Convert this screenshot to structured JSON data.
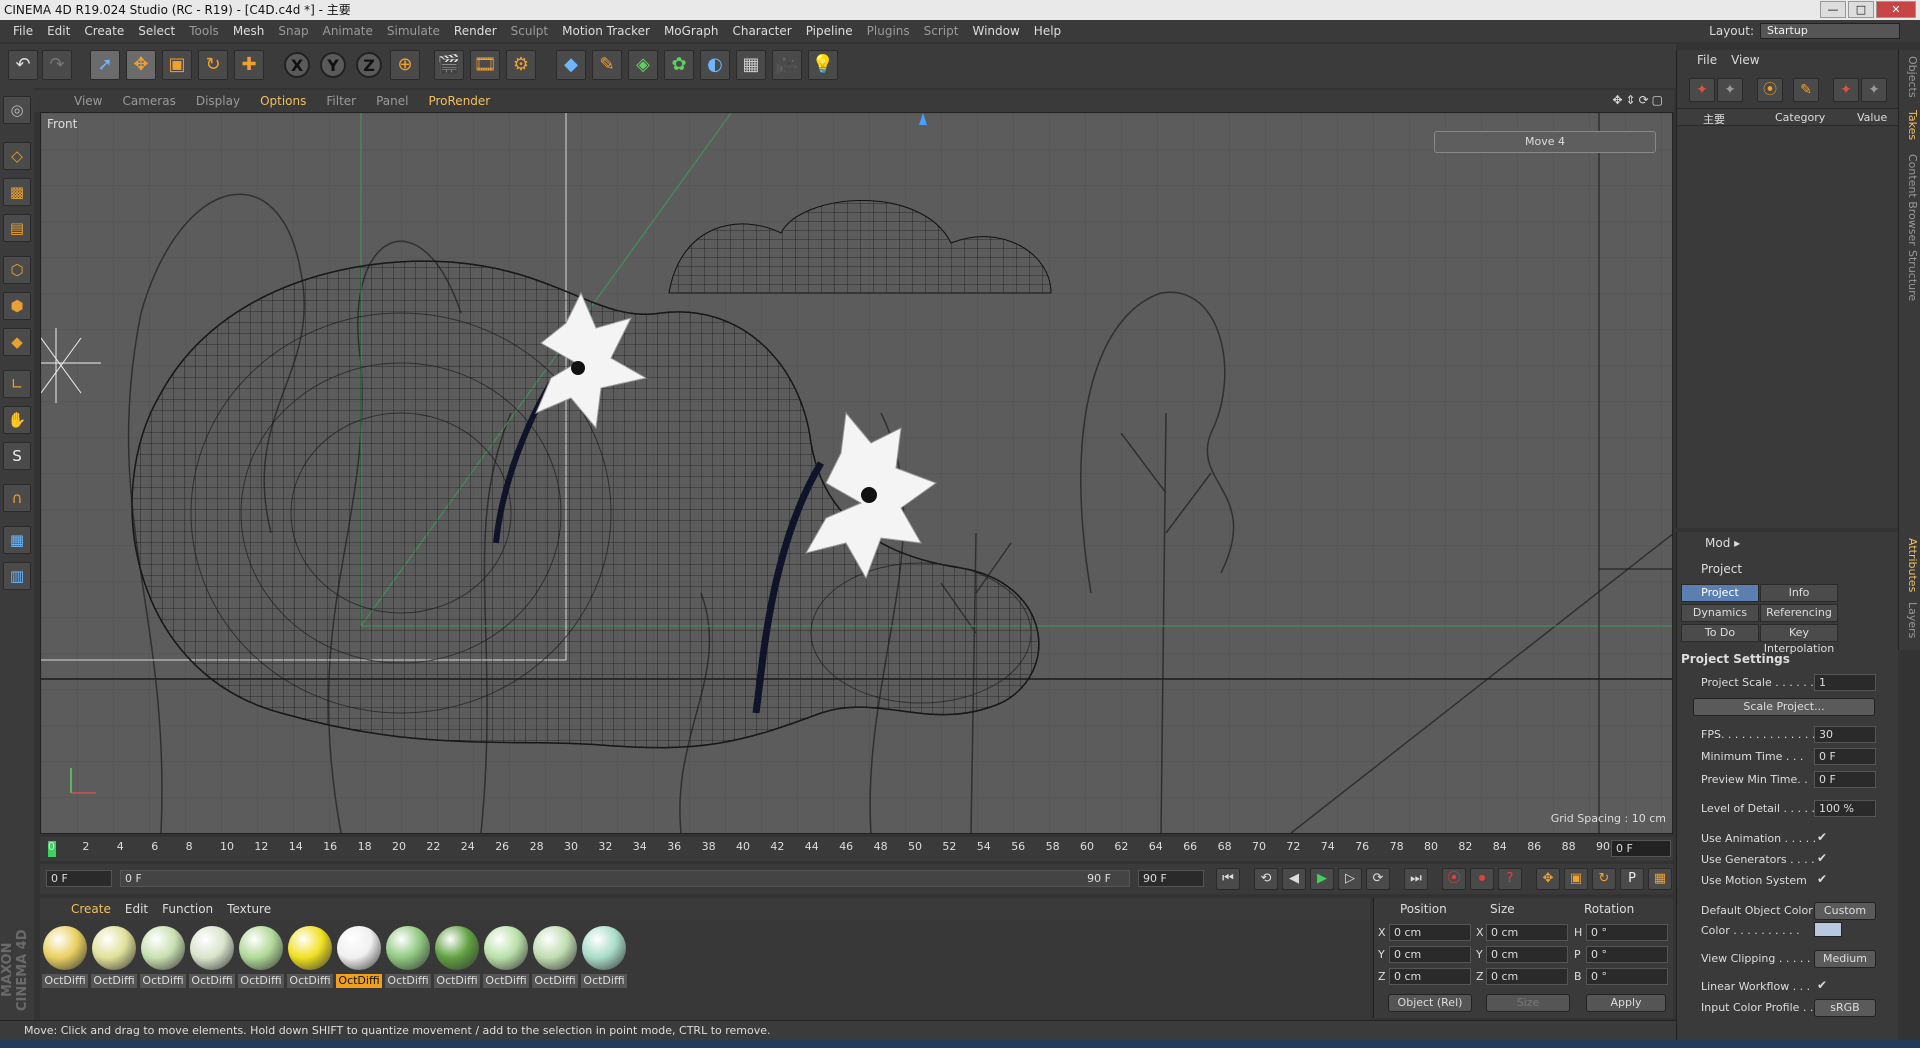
{
  "window": {
    "title": "CINEMA 4D R19.024 Studio (RC - R19) - [C4D.c4d *] - 主要",
    "buttons": [
      "—",
      "□",
      "✕"
    ]
  },
  "menu": [
    "File",
    "Edit",
    "Create",
    "Select",
    "Tools",
    "Mesh",
    "Snap",
    "Animate",
    "Simulate",
    "Render",
    "Sculpt",
    "Motion Tracker",
    "MoGraph",
    "Character",
    "Pipeline",
    "Plugins",
    "Script",
    "Window",
    "Help"
  ],
  "layout": {
    "label": "Layout:",
    "value": "Startup"
  },
  "toolbar_icons": [
    "undo-icon",
    "redo-icon",
    "select-live-icon",
    "move-icon",
    "scale-icon",
    "rotate-icon",
    "create-icon",
    "x-axis",
    "y-axis",
    "z-axis",
    "world-coords-icon",
    "render-view-icon",
    "render-picture-viewer-icon",
    "render-settings-icon",
    "cube-icon",
    "pen-icon",
    "subdivision-icon",
    "cloner-icon",
    "deformer-icon",
    "floor-icon",
    "camera-icon",
    "light-icon"
  ],
  "viewport": {
    "menu": [
      "View",
      "Cameras",
      "Display",
      "Options",
      "Filter",
      "Panel",
      "ProRender"
    ],
    "active_menu": "Options",
    "view_name": "Front",
    "hud_move": "Move 4",
    "grid_spacing": "Grid Spacing : 10 cm"
  },
  "timeline": {
    "ticks": [
      "0",
      "2",
      "4",
      "6",
      "8",
      "10",
      "12",
      "14",
      "16",
      "18",
      "20",
      "22",
      "24",
      "26",
      "28",
      "30",
      "32",
      "34",
      "36",
      "38",
      "40",
      "42",
      "44",
      "46",
      "48",
      "50",
      "52",
      "54",
      "56",
      "58",
      "60",
      "62",
      "64",
      "66",
      "68",
      "70",
      "72",
      "74",
      "76",
      "78",
      "80",
      "82",
      "84",
      "86",
      "88",
      "90"
    ],
    "current_frame": "0 F",
    "start": "0 F",
    "slider_start": "0 F",
    "slider_end": "90 F",
    "end": "90 F"
  },
  "materials": {
    "menu": [
      "Create",
      "Edit",
      "Function",
      "Texture"
    ],
    "active_menu": "Create",
    "items": [
      {
        "name": "OctDiffi",
        "color": "#e8d060"
      },
      {
        "name": "OctDiffi",
        "color": "#e0e098"
      },
      {
        "name": "OctDiffi",
        "color": "#c8e0b0"
      },
      {
        "name": "OctDiffi",
        "color": "#d8e4cc"
      },
      {
        "name": "OctDiffi",
        "color": "#b0d898"
      },
      {
        "name": "OctDiffi",
        "color": "#f0e020"
      },
      {
        "name": "OctDiffi",
        "color": "#f0f0f0",
        "selected": true
      },
      {
        "name": "OctDiffi",
        "color": "#90c880"
      },
      {
        "name": "OctDiffi",
        "color": "#60a040"
      },
      {
        "name": "OctDiffi",
        "color": "#b8e0a8"
      },
      {
        "name": "OctDiffi",
        "color": "#c0dcb0"
      },
      {
        "name": "OctDiffi",
        "color": "#a8dcc8"
      }
    ]
  },
  "coords": {
    "headers": [
      "Position",
      "Size",
      "Rotation"
    ],
    "rows": [
      {
        "axis": "X",
        "pos": "0 cm",
        "saxis": "X",
        "size": "0 cm",
        "raxis": "H",
        "rot": "0 °"
      },
      {
        "axis": "Y",
        "pos": "0 cm",
        "saxis": "Y",
        "size": "0 cm",
        "raxis": "P",
        "rot": "0 °"
      },
      {
        "axis": "Z",
        "pos": "0 cm",
        "saxis": "Z",
        "size": "0 cm",
        "raxis": "B",
        "rot": "0 °"
      }
    ],
    "mode": "Object (Rel)",
    "size_mode": "Size",
    "apply": "Apply"
  },
  "status": "Move: Click and drag to move elements. Hold down SHIFT to quantize movement / add to the selection in point mode, CTRL to remove.",
  "maxon": "MAXON CINEMA 4D",
  "object_manager": {
    "menu": [
      "File",
      "View"
    ],
    "columns": [
      "主要",
      "Category",
      "Value"
    ]
  },
  "side_tabs": [
    "Objects",
    "Takes",
    "Content Browser",
    "Structure"
  ],
  "side_tabs2": [
    "Attributes",
    "Layers"
  ],
  "attributes": {
    "mode": "Mod",
    "object": "Project",
    "tabs": [
      "Project Settings",
      "Info",
      "Dynamics",
      "Referencing",
      "To Do",
      "Key Interpolation"
    ],
    "section": "Project Settings",
    "scale_label": "Project Scale . . . . . .",
    "scale_value": "1",
    "scale_button": "Scale Project...",
    "fps_label": "FPS. . . . . . . . . . . . . .",
    "fps_value": "30",
    "min_time_label": "Minimum Time . . .",
    "min_time_value": "0 F",
    "preview_min_label": "Preview Min Time. .",
    "preview_min_value": "0 F",
    "lod_label": "Level of Detail . . . . .",
    "lod_value": "100 %",
    "use_animation": "Use Animation . . . . .",
    "use_generators": "Use Generators . . . .",
    "use_motion": "Use Motion System",
    "check": "✔",
    "default_color_label": "Default Object Color",
    "default_color_value": "Custom",
    "color_label": "Color . . . . . . . . . .",
    "color_swatch": "#b8c8e0",
    "view_clipping_label": "View Clipping . . . . .",
    "view_clipping_value": "Medium",
    "linear_workflow": "Linear Workflow . . .",
    "input_profile_label": "Input Color Profile . .",
    "input_profile_value": "sRGB"
  }
}
